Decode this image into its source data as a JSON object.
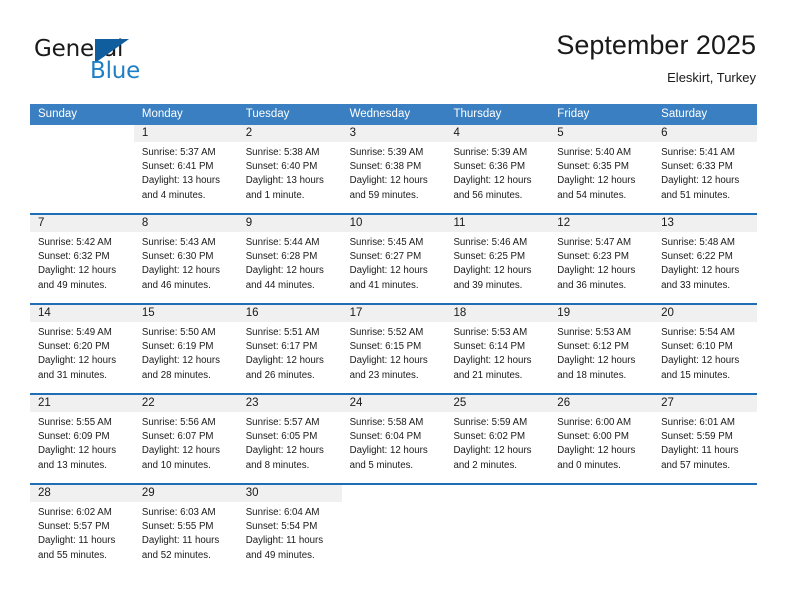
{
  "brand": {
    "name_top": "General",
    "name_bottom": "Blue",
    "accent_color": "#1f7fc4",
    "triangle_color": "#115e9e"
  },
  "header": {
    "month_title": "September 2025",
    "location": "Eleskirt, Turkey"
  },
  "calendar": {
    "header_color": "#3A7FC1",
    "separator_color": "#1F6EB5",
    "daynum_band_color": "#F0F0F0",
    "weekdays": [
      "Sunday",
      "Monday",
      "Tuesday",
      "Wednesday",
      "Thursday",
      "Friday",
      "Saturday"
    ],
    "weeks": [
      [
        {
          "day": "",
          "lines": []
        },
        {
          "day": "1",
          "lines": [
            "Sunrise: 5:37 AM",
            "Sunset: 6:41 PM",
            "Daylight: 13 hours",
            "and 4 minutes."
          ]
        },
        {
          "day": "2",
          "lines": [
            "Sunrise: 5:38 AM",
            "Sunset: 6:40 PM",
            "Daylight: 13 hours",
            "and 1 minute."
          ]
        },
        {
          "day": "3",
          "lines": [
            "Sunrise: 5:39 AM",
            "Sunset: 6:38 PM",
            "Daylight: 12 hours",
            "and 59 minutes."
          ]
        },
        {
          "day": "4",
          "lines": [
            "Sunrise: 5:39 AM",
            "Sunset: 6:36 PM",
            "Daylight: 12 hours",
            "and 56 minutes."
          ]
        },
        {
          "day": "5",
          "lines": [
            "Sunrise: 5:40 AM",
            "Sunset: 6:35 PM",
            "Daylight: 12 hours",
            "and 54 minutes."
          ]
        },
        {
          "day": "6",
          "lines": [
            "Sunrise: 5:41 AM",
            "Sunset: 6:33 PM",
            "Daylight: 12 hours",
            "and 51 minutes."
          ]
        }
      ],
      [
        {
          "day": "7",
          "lines": [
            "Sunrise: 5:42 AM",
            "Sunset: 6:32 PM",
            "Daylight: 12 hours",
            "and 49 minutes."
          ]
        },
        {
          "day": "8",
          "lines": [
            "Sunrise: 5:43 AM",
            "Sunset: 6:30 PM",
            "Daylight: 12 hours",
            "and 46 minutes."
          ]
        },
        {
          "day": "9",
          "lines": [
            "Sunrise: 5:44 AM",
            "Sunset: 6:28 PM",
            "Daylight: 12 hours",
            "and 44 minutes."
          ]
        },
        {
          "day": "10",
          "lines": [
            "Sunrise: 5:45 AM",
            "Sunset: 6:27 PM",
            "Daylight: 12 hours",
            "and 41 minutes."
          ]
        },
        {
          "day": "11",
          "lines": [
            "Sunrise: 5:46 AM",
            "Sunset: 6:25 PM",
            "Daylight: 12 hours",
            "and 39 minutes."
          ]
        },
        {
          "day": "12",
          "lines": [
            "Sunrise: 5:47 AM",
            "Sunset: 6:23 PM",
            "Daylight: 12 hours",
            "and 36 minutes."
          ]
        },
        {
          "day": "13",
          "lines": [
            "Sunrise: 5:48 AM",
            "Sunset: 6:22 PM",
            "Daylight: 12 hours",
            "and 33 minutes."
          ]
        }
      ],
      [
        {
          "day": "14",
          "lines": [
            "Sunrise: 5:49 AM",
            "Sunset: 6:20 PM",
            "Daylight: 12 hours",
            "and 31 minutes."
          ]
        },
        {
          "day": "15",
          "lines": [
            "Sunrise: 5:50 AM",
            "Sunset: 6:19 PM",
            "Daylight: 12 hours",
            "and 28 minutes."
          ]
        },
        {
          "day": "16",
          "lines": [
            "Sunrise: 5:51 AM",
            "Sunset: 6:17 PM",
            "Daylight: 12 hours",
            "and 26 minutes."
          ]
        },
        {
          "day": "17",
          "lines": [
            "Sunrise: 5:52 AM",
            "Sunset: 6:15 PM",
            "Daylight: 12 hours",
            "and 23 minutes."
          ]
        },
        {
          "day": "18",
          "lines": [
            "Sunrise: 5:53 AM",
            "Sunset: 6:14 PM",
            "Daylight: 12 hours",
            "and 21 minutes."
          ]
        },
        {
          "day": "19",
          "lines": [
            "Sunrise: 5:53 AM",
            "Sunset: 6:12 PM",
            "Daylight: 12 hours",
            "and 18 minutes."
          ]
        },
        {
          "day": "20",
          "lines": [
            "Sunrise: 5:54 AM",
            "Sunset: 6:10 PM",
            "Daylight: 12 hours",
            "and 15 minutes."
          ]
        }
      ],
      [
        {
          "day": "21",
          "lines": [
            "Sunrise: 5:55 AM",
            "Sunset: 6:09 PM",
            "Daylight: 12 hours",
            "and 13 minutes."
          ]
        },
        {
          "day": "22",
          "lines": [
            "Sunrise: 5:56 AM",
            "Sunset: 6:07 PM",
            "Daylight: 12 hours",
            "and 10 minutes."
          ]
        },
        {
          "day": "23",
          "lines": [
            "Sunrise: 5:57 AM",
            "Sunset: 6:05 PM",
            "Daylight: 12 hours",
            "and 8 minutes."
          ]
        },
        {
          "day": "24",
          "lines": [
            "Sunrise: 5:58 AM",
            "Sunset: 6:04 PM",
            "Daylight: 12 hours",
            "and 5 minutes."
          ]
        },
        {
          "day": "25",
          "lines": [
            "Sunrise: 5:59 AM",
            "Sunset: 6:02 PM",
            "Daylight: 12 hours",
            "and 2 minutes."
          ]
        },
        {
          "day": "26",
          "lines": [
            "Sunrise: 6:00 AM",
            "Sunset: 6:00 PM",
            "Daylight: 12 hours",
            "and 0 minutes."
          ]
        },
        {
          "day": "27",
          "lines": [
            "Sunrise: 6:01 AM",
            "Sunset: 5:59 PM",
            "Daylight: 11 hours",
            "and 57 minutes."
          ]
        }
      ],
      [
        {
          "day": "28",
          "lines": [
            "Sunrise: 6:02 AM",
            "Sunset: 5:57 PM",
            "Daylight: 11 hours",
            "and 55 minutes."
          ]
        },
        {
          "day": "29",
          "lines": [
            "Sunrise: 6:03 AM",
            "Sunset: 5:55 PM",
            "Daylight: 11 hours",
            "and 52 minutes."
          ]
        },
        {
          "day": "30",
          "lines": [
            "Sunrise: 6:04 AM",
            "Sunset: 5:54 PM",
            "Daylight: 11 hours",
            "and 49 minutes."
          ]
        },
        {
          "day": "",
          "lines": []
        },
        {
          "day": "",
          "lines": []
        },
        {
          "day": "",
          "lines": []
        },
        {
          "day": "",
          "lines": []
        }
      ]
    ]
  }
}
